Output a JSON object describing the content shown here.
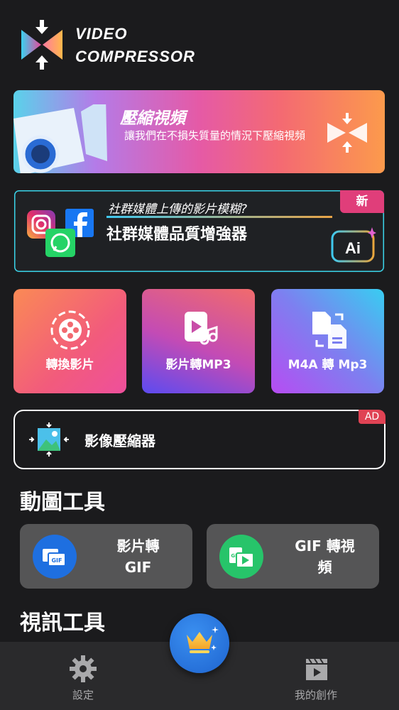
{
  "app": {
    "title_line1": "VIDEO",
    "title_line2": "COMPRESSOR"
  },
  "banner_compress": {
    "title": "壓縮視頻",
    "description": "讓我們在不損失質量的情況下壓縮視頻"
  },
  "banner_social": {
    "question": "社群媒體上傳的影片模糊?",
    "title": "社群媒體品質增強器",
    "badge": "新",
    "ai_label": "Ai"
  },
  "tiles": [
    {
      "label": "轉換影片"
    },
    {
      "label": "影片轉MP3"
    },
    {
      "label": "M4A 轉 Mp3"
    }
  ],
  "image_compressor": {
    "label": "影像壓縮器",
    "ad_badge": "AD"
  },
  "sections": {
    "gif_tools": "動圖工具",
    "video_tools": "視訊工具"
  },
  "gif_tools": [
    {
      "label_line1": "影片轉",
      "label_line2": "GIF",
      "icon_text": "GIF"
    },
    {
      "label_line1": "GIF 轉視",
      "label_line2": "頻",
      "icon_text": "GIF"
    }
  ],
  "nav": {
    "settings": "設定",
    "my_creations": "我的創作"
  },
  "colors": {
    "background": "#1b1b1d",
    "nav_background": "#2a2a2c",
    "accent_blue": "#1e6fe0",
    "accent_green": "#27c46a",
    "badge_pink": "#e03e7a",
    "ad_red": "#e04354"
  }
}
